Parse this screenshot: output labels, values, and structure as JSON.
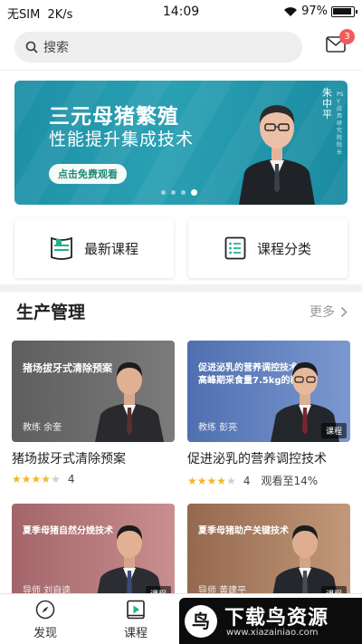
{
  "status_bar": {
    "carrier": "无SIM",
    "speed": "2K/s",
    "time": "14:09",
    "battery": "97%",
    "battery_level": 0.97
  },
  "header": {
    "search_placeholder": "搜索",
    "mail_badge": "3"
  },
  "banner": {
    "title": "三元母猪繁殖",
    "subtitle": "性能提升集成技术",
    "cta": "点击免费观看",
    "speaker_name": "朱中平",
    "speaker_title": "PSY应用研究院院长",
    "slides": 4,
    "active_slide": 4
  },
  "quick_links": [
    {
      "label": "最新课程",
      "icon": "book-icon"
    },
    {
      "label": "课程分类",
      "icon": "list-icon"
    }
  ],
  "section": {
    "title": "生产管理",
    "more": "更多"
  },
  "courses": [
    {
      "thumb_title": "猪场拔牙式清除预案",
      "teacher": "教练 余奎",
      "name": "猪场拔牙式清除预案",
      "rating": 4,
      "rating_text": "4",
      "progress": "",
      "tag": "",
      "bg": "#6d6d6d"
    },
    {
      "thumb_title": "促进泌乳的营养调控技术\n高峰期采食量7.5kg的秘诀",
      "teacher": "教练 彭亮",
      "name": "促进泌乳的营养调控技术",
      "rating": 4,
      "rating_text": "4",
      "progress": "观看至14%",
      "tag": "课程",
      "bg": "#5d78b5"
    },
    {
      "thumb_title": "夏季母猪自然分娩技术",
      "teacher": "导师 刘自逵",
      "name": "",
      "rating": 0,
      "rating_text": "",
      "progress": "",
      "tag": "课程",
      "bg": "#b06f73"
    },
    {
      "thumb_title": "夏季母猪助产关键技术",
      "teacher": "导师 黄建平",
      "name": "",
      "rating": 0,
      "rating_text": "",
      "progress": "",
      "tag": "课程",
      "bg": "#9b6e51"
    }
  ],
  "tabs": [
    {
      "label": "发现",
      "icon": "compass-icon"
    },
    {
      "label": "课程",
      "icon": "play-icon"
    }
  ],
  "watermark": {
    "logo_char": "鸟",
    "text": "下载鸟资源",
    "url": "www.xiazainiao.com"
  }
}
